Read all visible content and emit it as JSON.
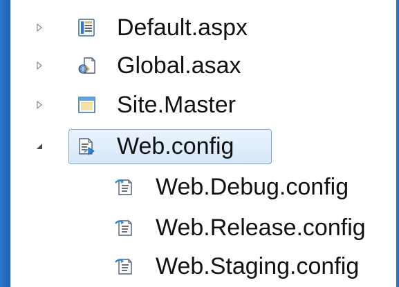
{
  "tree": {
    "items": [
      {
        "label": "Default.aspx",
        "expander": "collapsed",
        "icon": "aspx-page-icon"
      },
      {
        "label": "Global.asax",
        "expander": "collapsed",
        "icon": "global-asax-icon"
      },
      {
        "label": "Site.Master",
        "expander": "collapsed",
        "icon": "master-page-icon"
      },
      {
        "label": "Web.config",
        "expander": "expanded",
        "icon": "web-config-icon",
        "selected": true,
        "children": [
          {
            "label": "Web.Debug.config",
            "icon": "config-transform-icon"
          },
          {
            "label": "Web.Release.config",
            "icon": "config-transform-icon"
          },
          {
            "label": "Web.Staging.config",
            "icon": "config-transform-icon"
          }
        ]
      }
    ]
  },
  "colors": {
    "selection_border": "#7da2ce",
    "selection_fill_top": "#eaf3fd",
    "selection_fill_bottom": "#d6e8fb",
    "frame_blue": "#1f6fc6"
  }
}
